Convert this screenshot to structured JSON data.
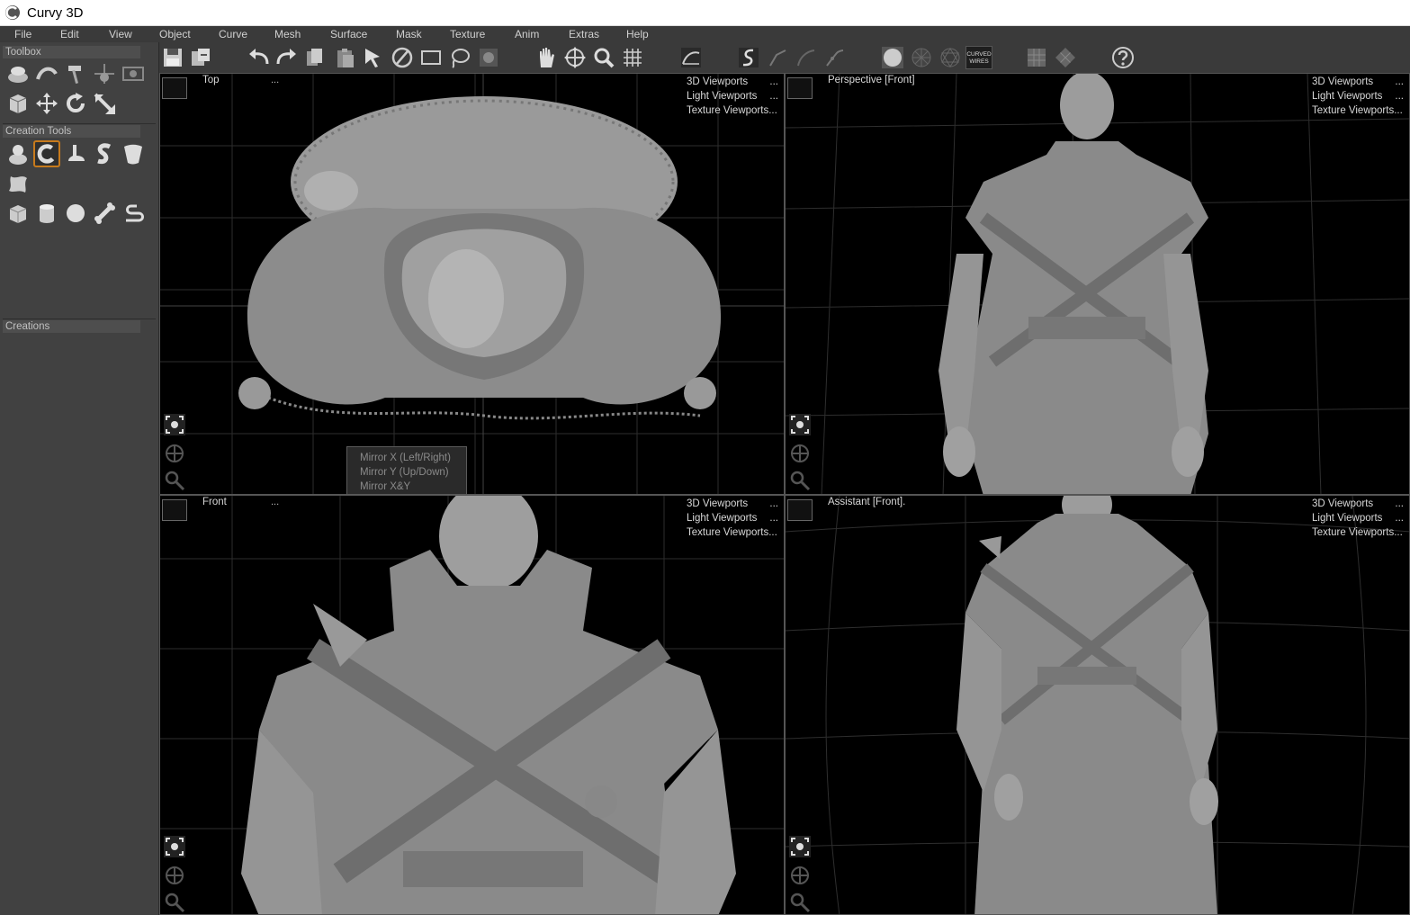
{
  "window": {
    "title": "Curvy 3D"
  },
  "menu": [
    "File",
    "Edit",
    "View",
    "Object",
    "Curve",
    "Mesh",
    "Surface",
    "Mask",
    "Texture",
    "Anim",
    "Extras",
    "Help"
  ],
  "sidebar": {
    "toolbox_label": "Toolbox",
    "creation_tools_label": "Creation Tools",
    "creations_label": "Creations"
  },
  "toolbar": {
    "curved_wires_label": "CURVED WIRES"
  },
  "viewports": {
    "top": {
      "name": "Top",
      "dots": "...",
      "menu": [
        "3D Viewports",
        "Light Viewports",
        "Texture Viewports..."
      ]
    },
    "persp": {
      "name": "Perspective [Front]",
      "dots": "",
      "menu": [
        "3D Viewports",
        "Light Viewports",
        "Texture Viewports..."
      ]
    },
    "front": {
      "name": "Front",
      "dots": "...",
      "menu": [
        "3D Viewports",
        "Light Viewports",
        "Texture Viewports..."
      ]
    },
    "assist": {
      "name": "Assistant [Front].",
      "dots": "",
      "menu": [
        "3D Viewports",
        "Light Viewports",
        "Texture Viewports..."
      ]
    }
  },
  "menu_dots": "...",
  "mirror_popup": [
    "Mirror X (Left/Right)",
    "Mirror Y (Up/Down)",
    "Mirror X&Y"
  ],
  "colors": {
    "accent": "#c77a1c",
    "viewport_bg": "#000000",
    "grid": "#3a3a3a",
    "ui_bg": "#3c3c3c"
  }
}
